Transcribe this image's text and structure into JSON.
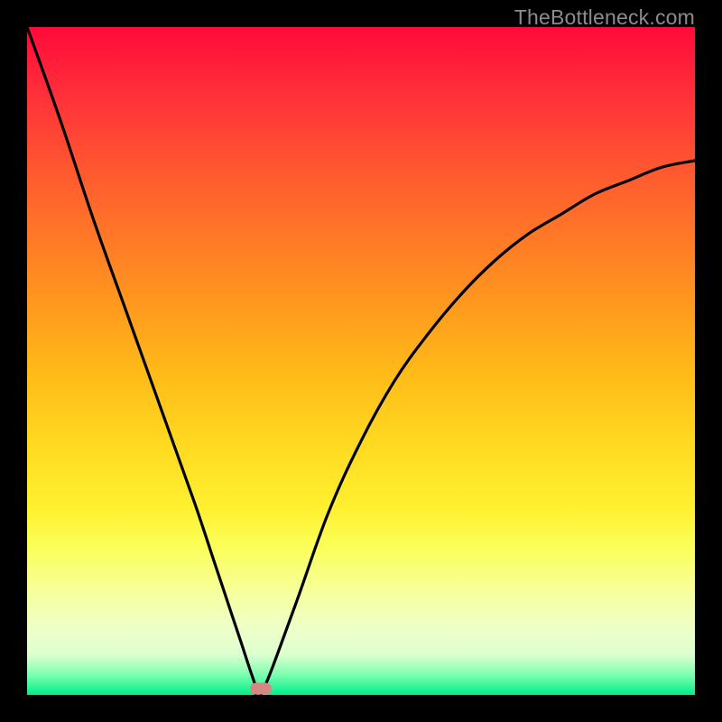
{
  "watermark": "TheBottleneck.com",
  "chart_data": {
    "type": "line",
    "title": "",
    "xlabel": "",
    "ylabel": "",
    "xlim": [
      0,
      100
    ],
    "ylim": [
      0,
      100
    ],
    "grid": false,
    "legend": false,
    "series": [
      {
        "name": "bottleneck-curve",
        "x": [
          0,
          5,
          10,
          15,
          20,
          25,
          28,
          30,
          32,
          34,
          35,
          40,
          45,
          50,
          55,
          60,
          65,
          70,
          75,
          80,
          85,
          90,
          95,
          100
        ],
        "values": [
          100,
          86,
          71,
          57,
          43,
          29,
          20,
          14,
          8,
          2,
          0,
          13,
          27,
          38,
          47,
          54,
          60,
          65,
          69,
          72,
          75,
          77,
          79,
          80
        ]
      }
    ],
    "marker": {
      "x": 35,
      "y": 1
    },
    "colors": {
      "background_gradient_top": "#ff0a3a",
      "background_gradient_bottom": "#00ee8a",
      "curve": "#000000",
      "marker": "#d58882",
      "frame": "#000000",
      "watermark": "#8c8c8c"
    }
  }
}
